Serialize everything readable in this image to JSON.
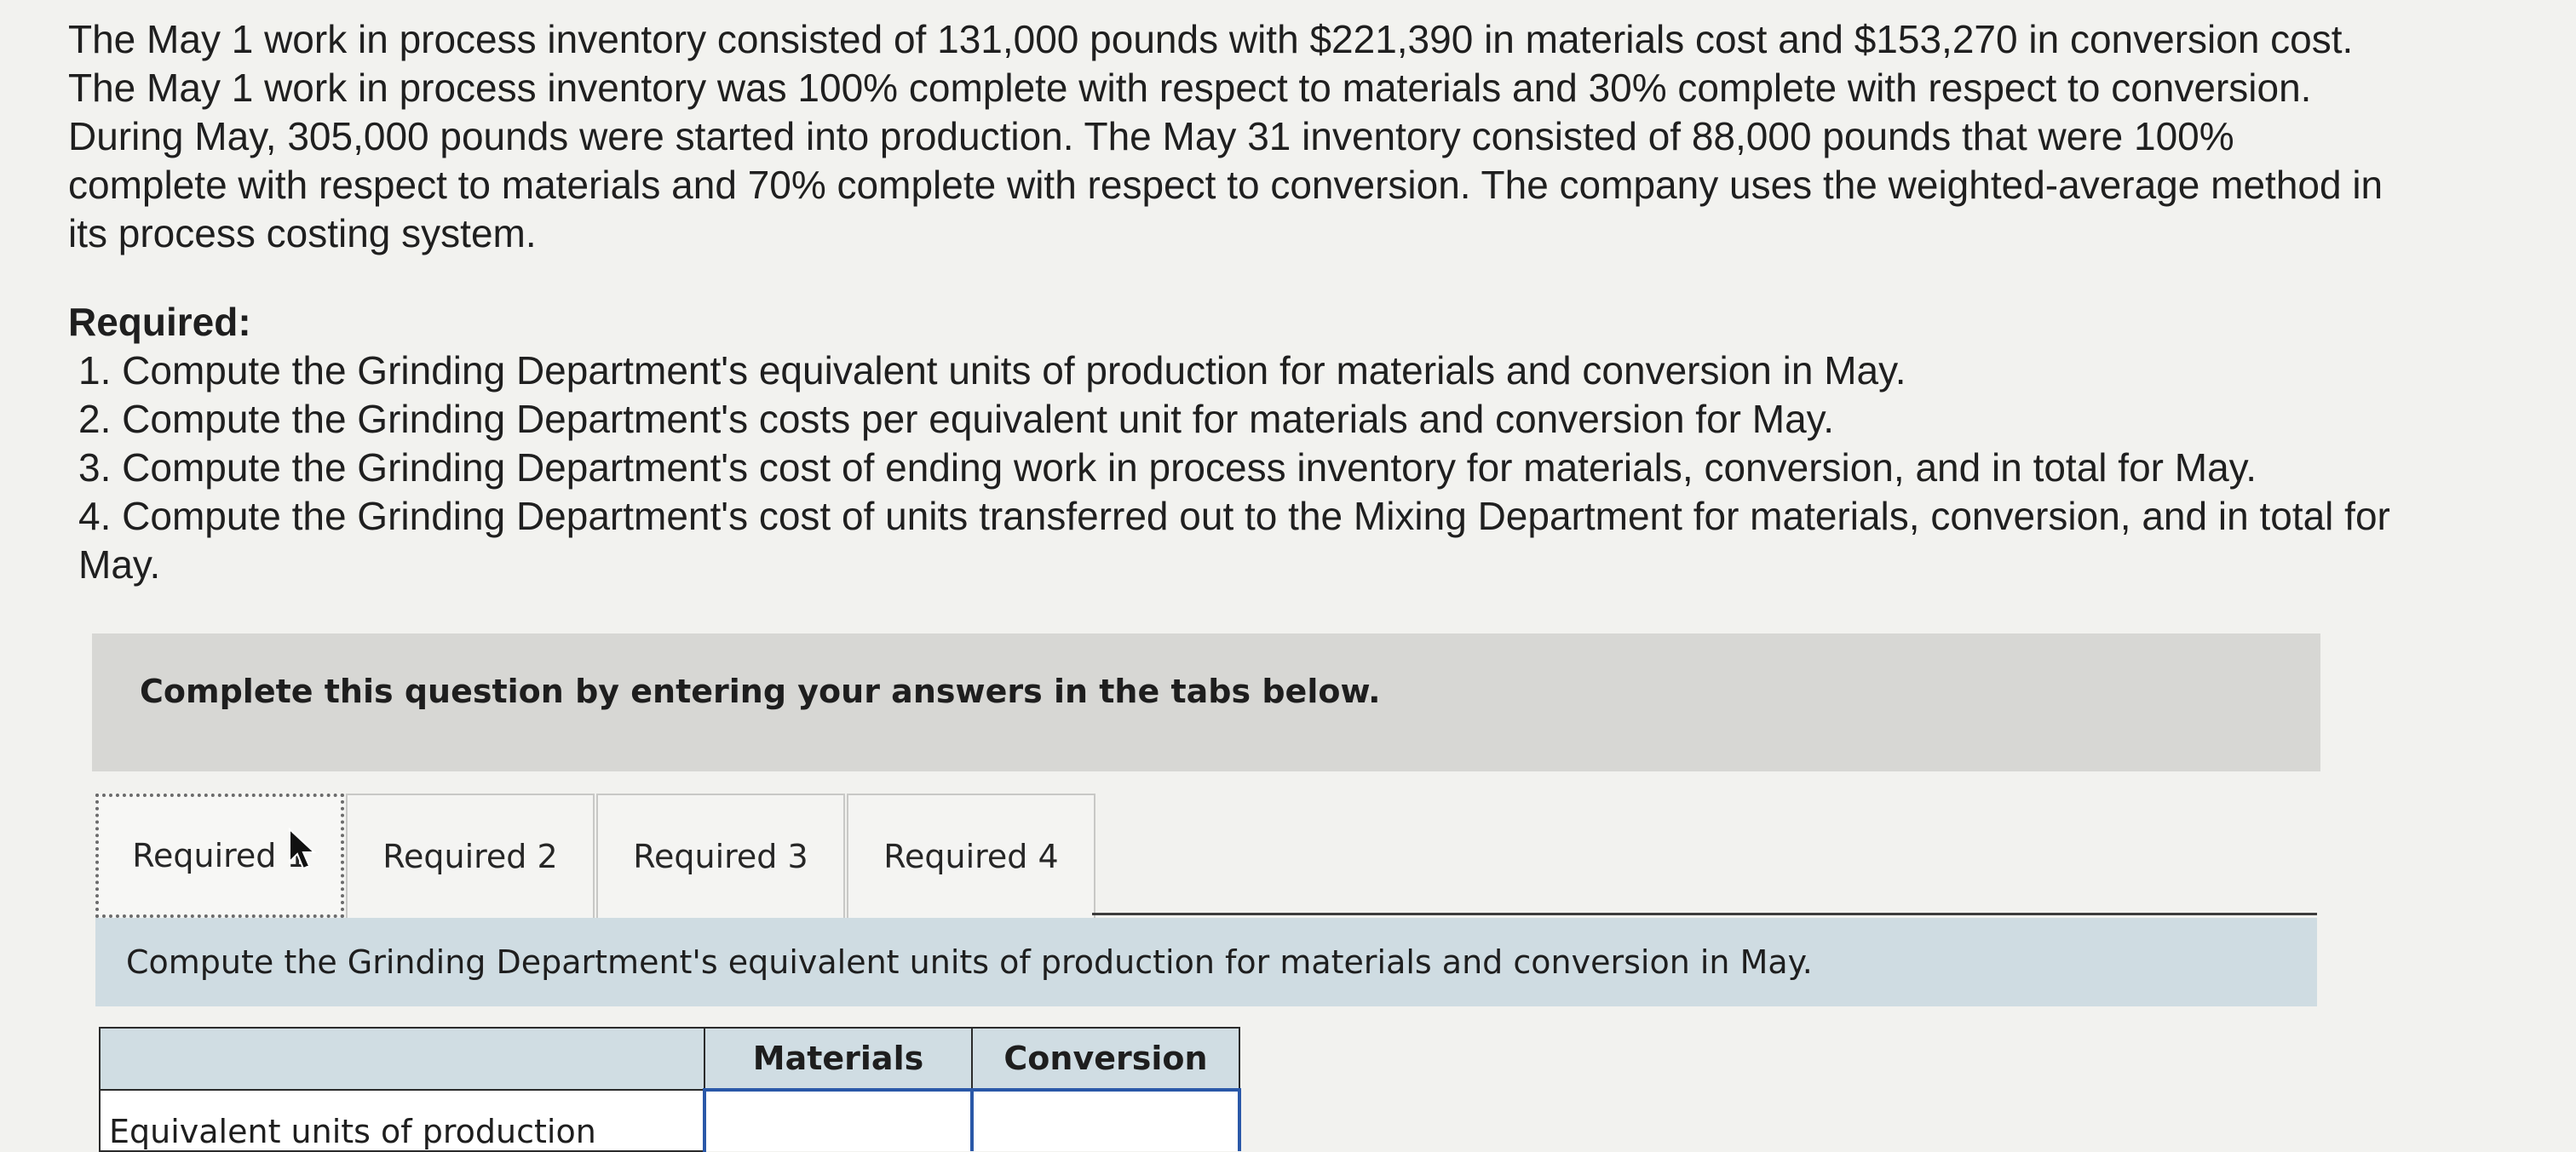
{
  "problem": {
    "lines": [
      "The May 1 work in process inventory consisted of 131,000 pounds with $221,390 in materials cost and $153,270 in conversion cost.",
      "The May 1 work in process inventory was 100% complete with respect to materials and 30% complete with respect to conversion.",
      "During May, 305,000 pounds were started into production. The May 31 inventory consisted of 88,000 pounds that were 100%",
      "complete with respect to materials and 70% complete with respect to conversion. The company uses the weighted-average method in",
      "its process costing system."
    ]
  },
  "required": {
    "heading": "Required:",
    "items": [
      "1. Compute the Grinding Department's equivalent units of production for materials and conversion in May.",
      "2. Compute the Grinding Department's costs per equivalent unit for materials and conversion for May.",
      "3. Compute the Grinding Department's cost of ending work in process inventory for materials, conversion, and in total for May.",
      "4. Compute the Grinding Department's cost of units transferred out to the Mixing Department for materials, conversion, and in total for",
      "May."
    ]
  },
  "instruction": "Complete this question by entering your answers in the tabs below.",
  "tabs": [
    {
      "label": "Required 1"
    },
    {
      "label": "Required 2"
    },
    {
      "label": "Required 3"
    },
    {
      "label": "Required 4"
    }
  ],
  "active_tab": "Required 1",
  "panel": {
    "prompt": "Compute the Grinding Department's equivalent units of production for materials and conversion in May."
  },
  "table": {
    "headers": [
      "",
      "Materials",
      "Conversion"
    ],
    "rows": [
      {
        "label": "Equivalent units of production",
        "materials": "",
        "conversion": ""
      }
    ]
  },
  "icons": {
    "cursor": "mouse-pointer-icon"
  },
  "colors": {
    "input_border": "#2a58a8",
    "panel_header": "#cfdce2",
    "instruction_bg": "#d7d7d4"
  }
}
